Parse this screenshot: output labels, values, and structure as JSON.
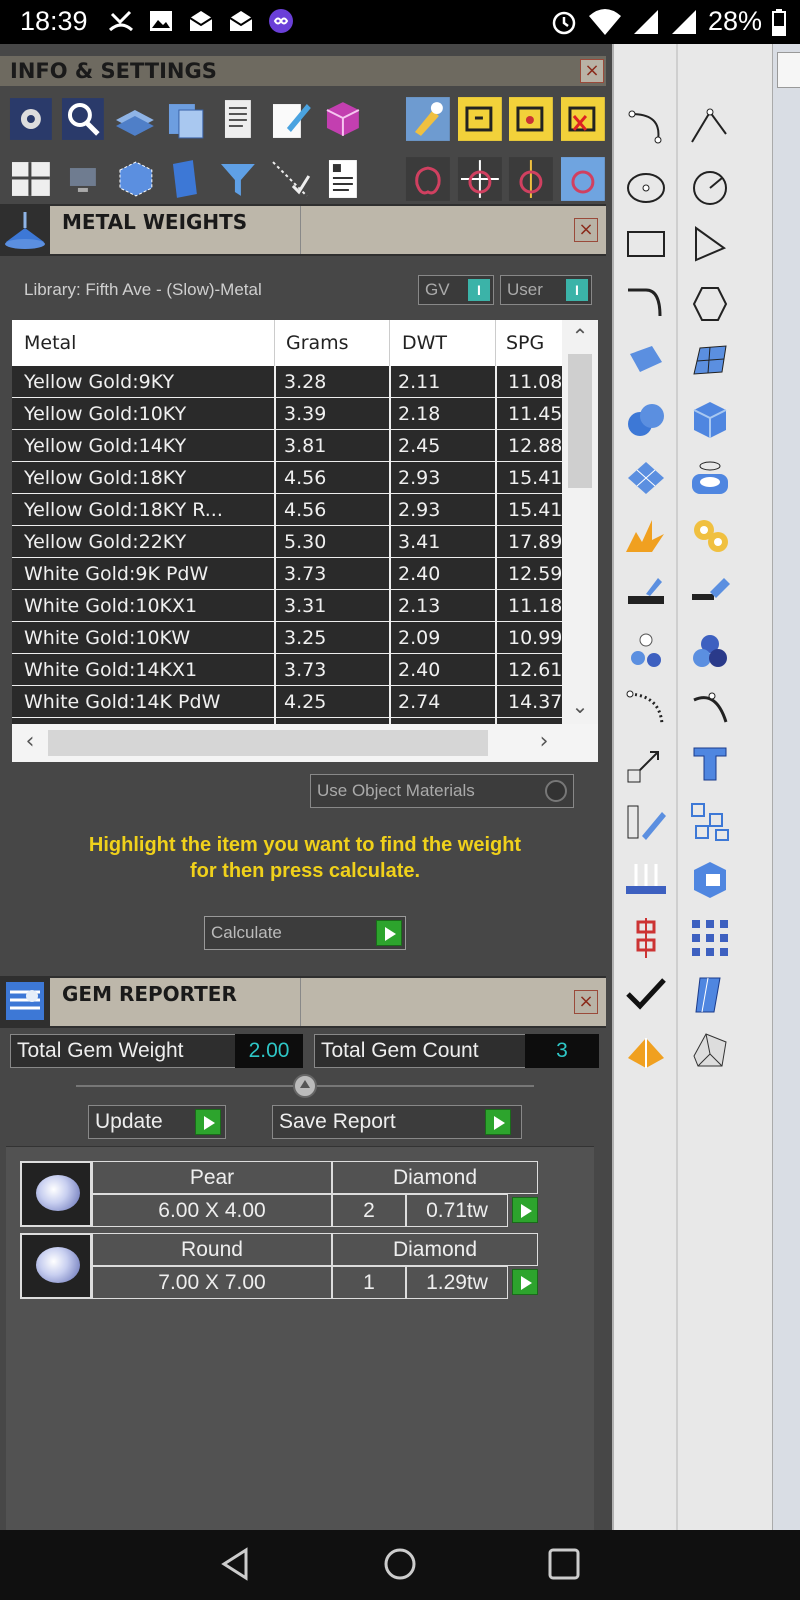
{
  "status_bar": {
    "time": "18:39",
    "battery": "28%"
  },
  "info_settings": {
    "title": "INFO & SETTINGS",
    "close": "×"
  },
  "metal_weights": {
    "title": "METAL WEIGHTS",
    "close": "×",
    "library": "Library: Fifth Ave - (Slow)-Metal",
    "gv_label": "GV",
    "user_label": "User",
    "toggle_glyph": "I",
    "columns": [
      "Metal",
      "Grams",
      "DWT",
      "SPG"
    ],
    "rows": [
      [
        "Yellow Gold:9KY",
        "3.28",
        "2.11",
        "11.08"
      ],
      [
        "Yellow Gold:10KY",
        "3.39",
        "2.18",
        "11.45"
      ],
      [
        "Yellow Gold:14KY",
        "3.81",
        "2.45",
        "12.88"
      ],
      [
        "Yellow Gold:18KY",
        "4.56",
        "2.93",
        "15.41"
      ],
      [
        "Yellow Gold:18KY R...",
        "4.56",
        "2.93",
        "15.41"
      ],
      [
        "Yellow Gold:22KY",
        "5.30",
        "3.41",
        "17.89"
      ],
      [
        "White Gold:9K PdW",
        "3.73",
        "2.40",
        "12.59"
      ],
      [
        "White Gold:10KX1",
        "3.31",
        "2.13",
        "11.18"
      ],
      [
        "White Gold:10KW",
        "3.25",
        "2.09",
        "10.99"
      ],
      [
        "White Gold:14KX1",
        "3.73",
        "2.40",
        "12.61"
      ],
      [
        "White Gold:14K PdW",
        "4.25",
        "2.74",
        "14.37"
      ]
    ],
    "use_object_materials": "Use Object Materials",
    "hint_line1": "Highlight the item you want to find the weight",
    "hint_line2": "for then press calculate.",
    "calculate": "Calculate"
  },
  "gem_reporter": {
    "title": "GEM REPORTER",
    "close": "×",
    "total_weight_label": "Total Gem Weight",
    "total_weight_value": "2.00",
    "total_count_label": "Total Gem Count",
    "total_count_value": "3",
    "update": "Update",
    "save_report": "Save Report",
    "gems": [
      {
        "shape": "Pear",
        "material": "Diamond",
        "size": "6.00 X 4.00",
        "count": "2",
        "weight": "0.71tw"
      },
      {
        "shape": "Round",
        "material": "Diamond",
        "size": "7.00 X 7.00",
        "count": "1",
        "weight": "1.29tw"
      }
    ]
  },
  "colors": {
    "accent_yellow": "#f0d11b",
    "value_cyan": "#2ec6c6",
    "play_green": "#2da42d"
  }
}
